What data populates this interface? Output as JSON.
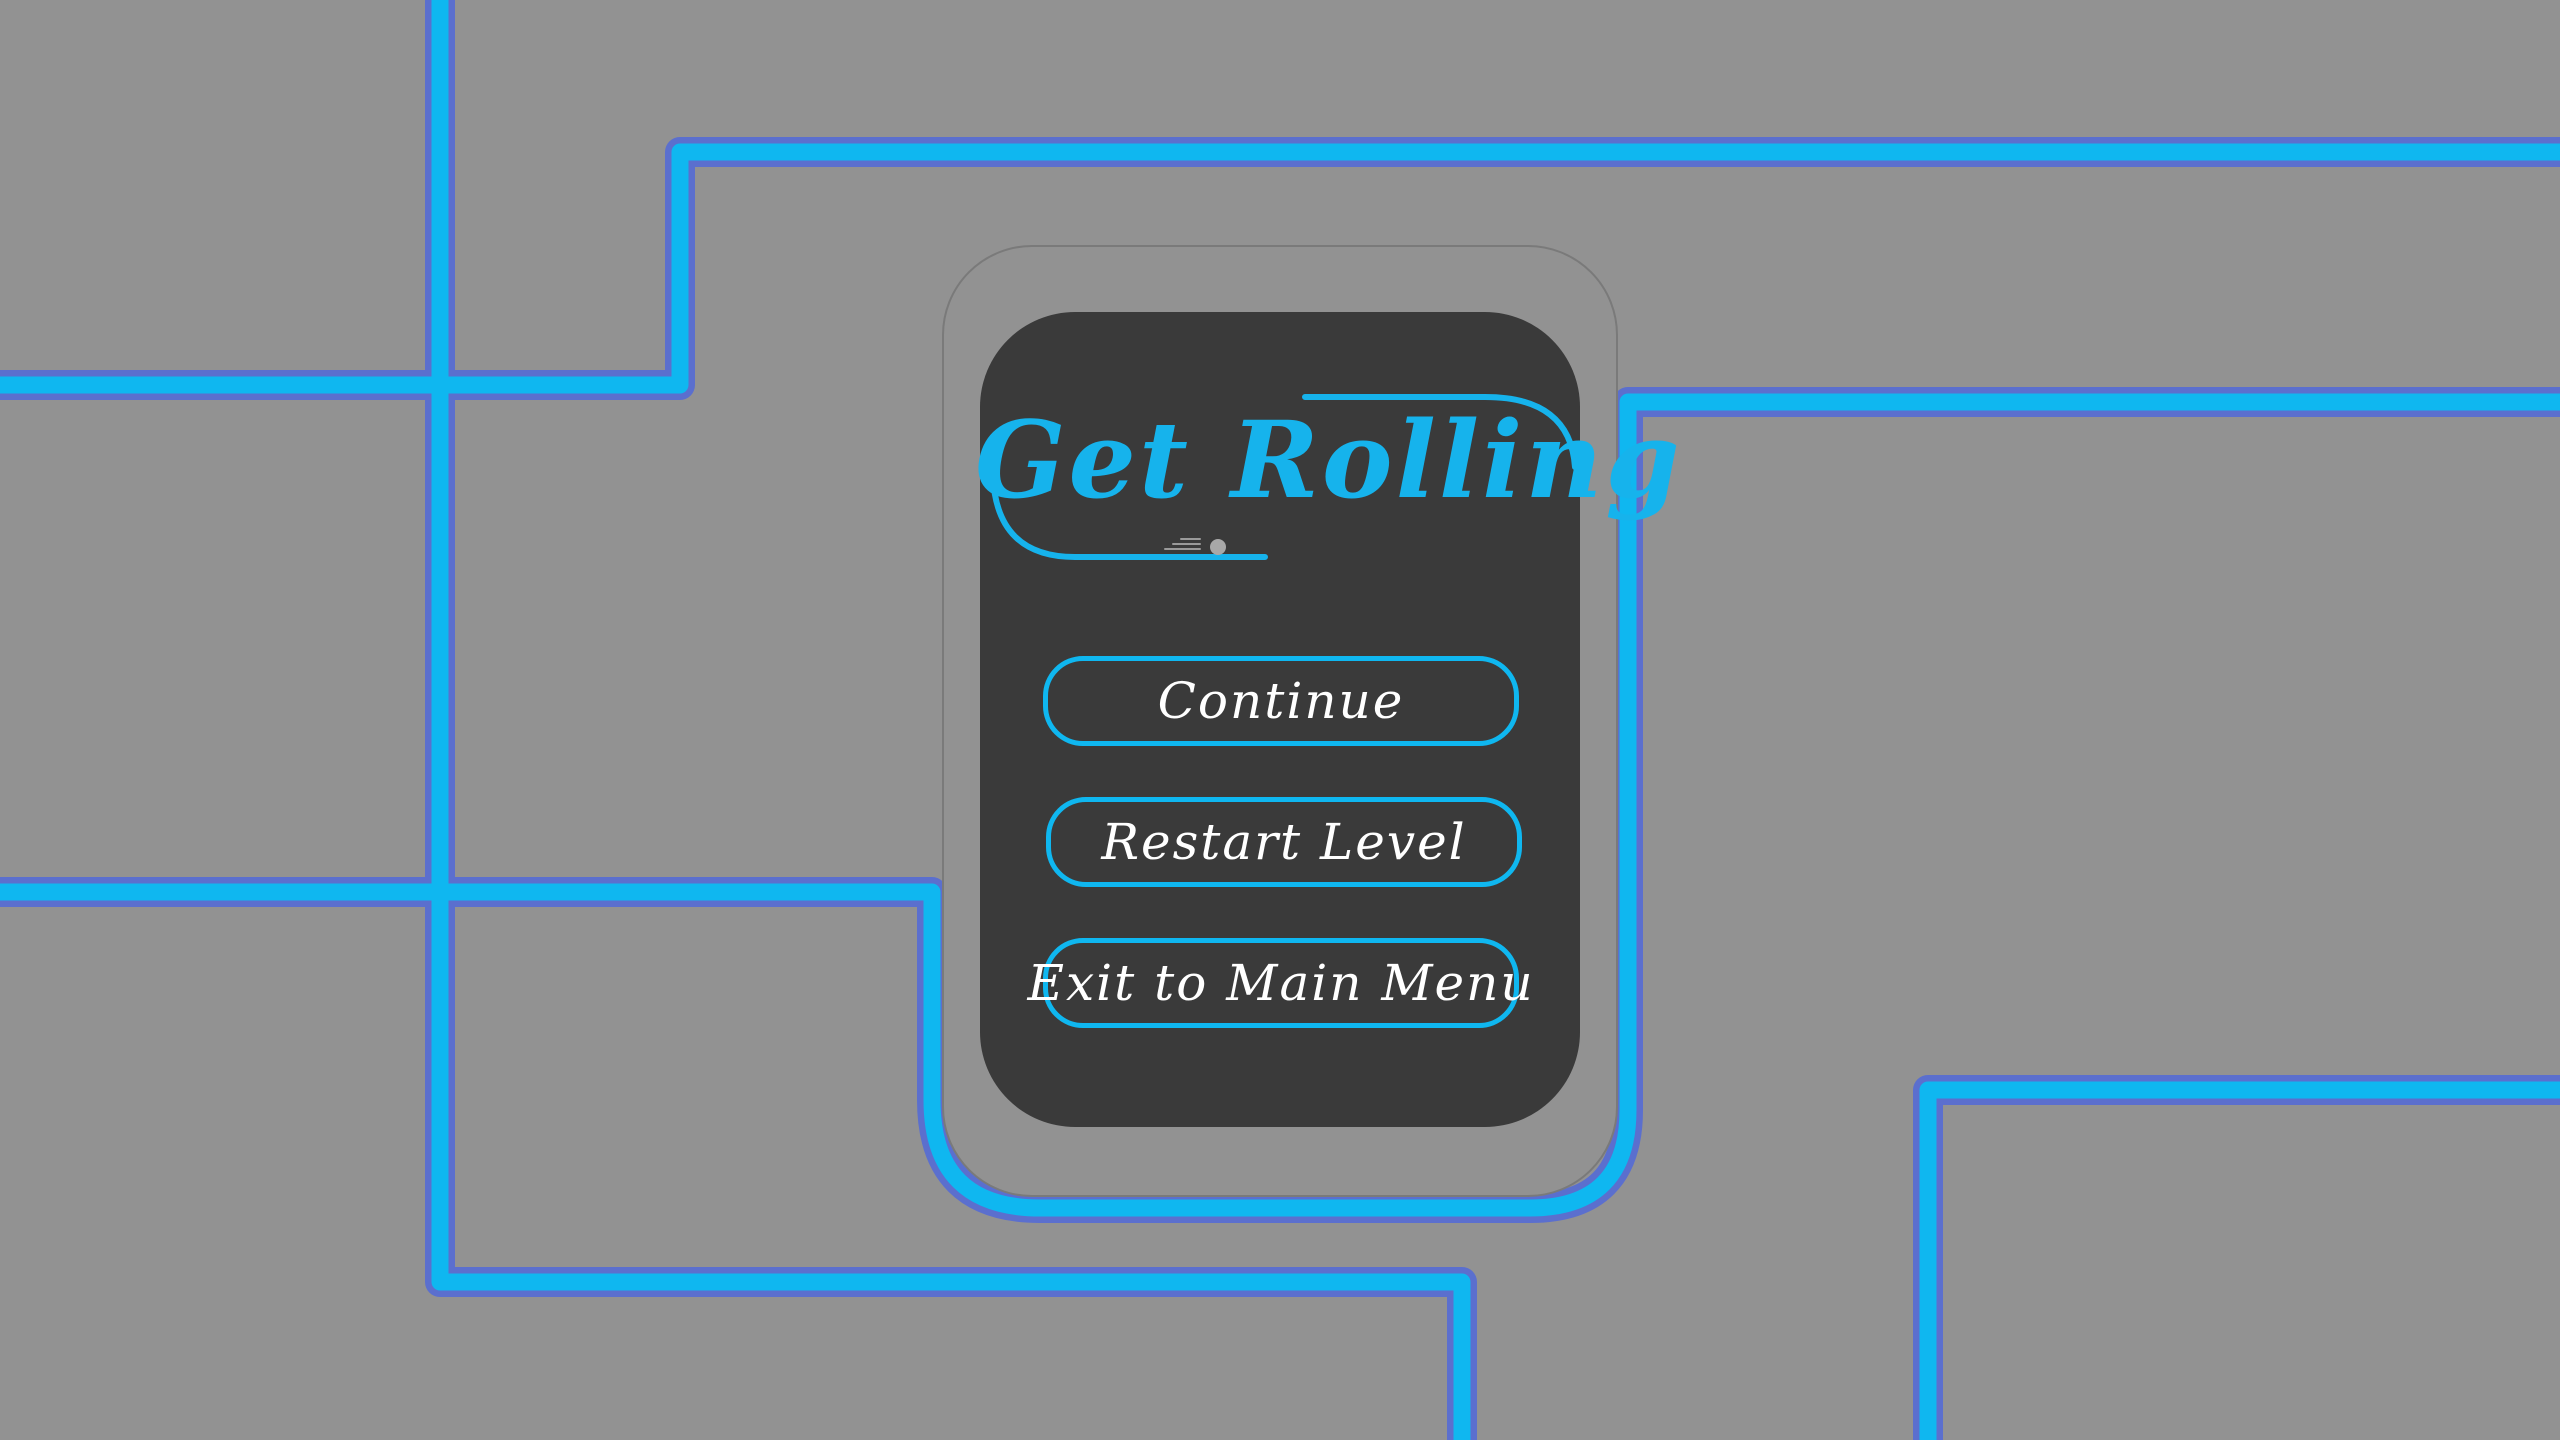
{
  "game": {
    "title": "Get Rolling"
  },
  "pause_menu": {
    "buttons": [
      {
        "label": "Continue"
      },
      {
        "label": "Restart Level"
      },
      {
        "label": "Exit to Main Menu"
      }
    ]
  },
  "colors": {
    "background": "#929292",
    "track_fill": "#0fb7f0",
    "track_border": "#5b6fce",
    "panel_inner": "#3a3a3a",
    "title": "#16b3ec",
    "button_border": "#0fb7f0",
    "button_text": "#ffffff"
  }
}
